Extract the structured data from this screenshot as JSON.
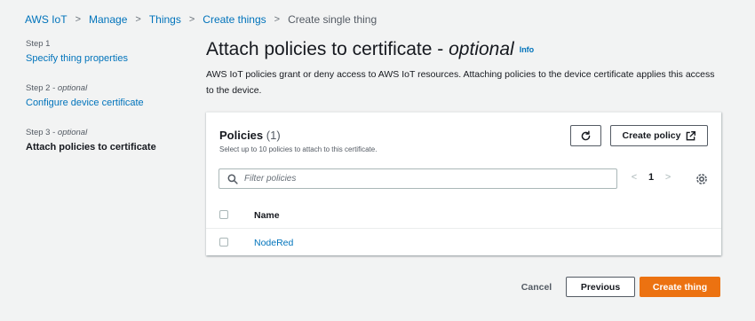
{
  "breadcrumb": {
    "items": [
      {
        "label": "AWS IoT",
        "link": true
      },
      {
        "label": "Manage",
        "link": true
      },
      {
        "label": "Things",
        "link": true
      },
      {
        "label": "Create things",
        "link": true
      },
      {
        "label": "Create single thing",
        "link": false
      }
    ]
  },
  "steps": [
    {
      "label": "Step 1",
      "optional": "",
      "title": "Specify thing properties",
      "active": false
    },
    {
      "label": "Step 2 - ",
      "optional": "optional",
      "title": "Configure device certificate",
      "active": false
    },
    {
      "label": "Step 3 - ",
      "optional": "optional",
      "title": "Attach policies to certificate",
      "active": true
    }
  ],
  "header": {
    "title": "Attach policies to certificate - ",
    "title_optional": "optional",
    "info": "Info",
    "description": "AWS IoT policies grant or deny access to AWS IoT resources. Attaching policies to the device certificate applies this access to the device."
  },
  "panel": {
    "title": "Policies",
    "count": "(1)",
    "subtitle": "Select up to 10 policies to attach to this certificate.",
    "create_policy_label": "Create policy",
    "filter_placeholder": "Filter policies",
    "page": "1",
    "column_name": "Name",
    "rows": [
      {
        "name": "NodeRed"
      }
    ]
  },
  "footer": {
    "cancel": "Cancel",
    "previous": "Previous",
    "create_thing": "Create thing"
  },
  "colors": {
    "link": "#0073bb",
    "primary": "#ec7211",
    "background": "#f2f3f3"
  }
}
